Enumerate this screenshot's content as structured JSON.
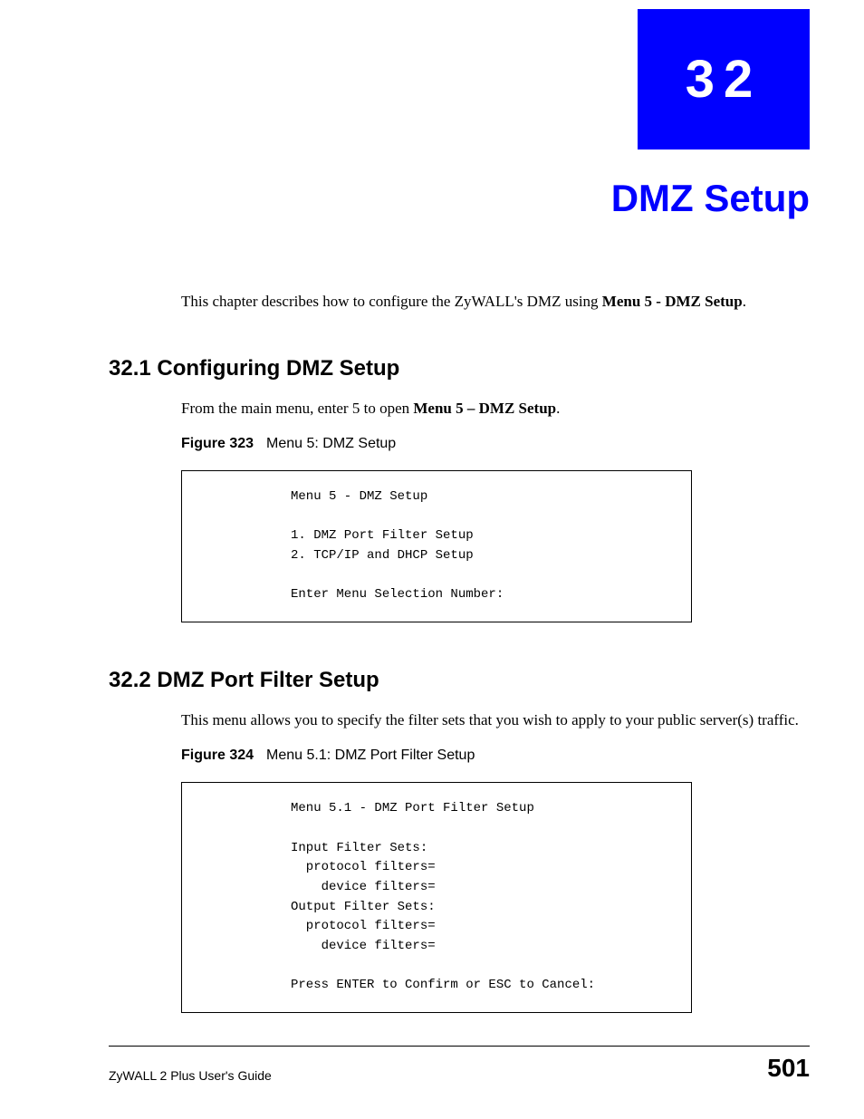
{
  "chapter": {
    "number": "32",
    "title": "DMZ Setup"
  },
  "intro": {
    "text_before": "This chapter describes how to configure the ZyWALL's DMZ using ",
    "bold": "Menu 5 - DMZ Setup",
    "text_after": "."
  },
  "section1": {
    "heading": "32.1  Configuring DMZ Setup",
    "para_before": "From the main menu, enter 5 to open ",
    "para_bold": "Menu 5 – DMZ Setup",
    "para_after": ".",
    "figure_num": "Figure 323",
    "figure_title": "Menu 5: DMZ Setup",
    "code": "Menu 5 - DMZ Setup\n\n1. DMZ Port Filter Setup\n2. TCP/IP and DHCP Setup\n\nEnter Menu Selection Number:"
  },
  "section2": {
    "heading": "32.2  DMZ Port Filter Setup",
    "para": "This menu allows you to specify the filter sets that you wish to apply to your public server(s) traffic.",
    "figure_num": "Figure 324",
    "figure_title": "Menu 5.1: DMZ Port Filter Setup",
    "code": "Menu 5.1 - DMZ Port Filter Setup\n\nInput Filter Sets:\n  protocol filters=\n    device filters=\nOutput Filter Sets:\n  protocol filters=\n    device filters=\n\nPress ENTER to Confirm or ESC to Cancel:"
  },
  "footer": {
    "guide": "ZyWALL 2 Plus User's Guide",
    "page": "501"
  }
}
